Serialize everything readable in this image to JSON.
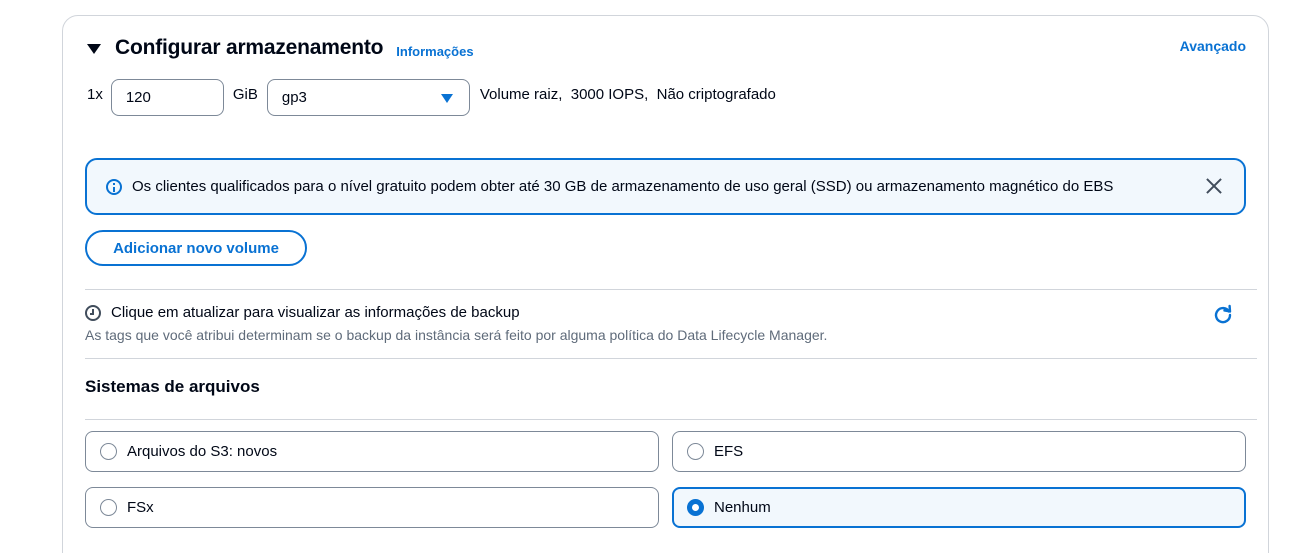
{
  "storage": {
    "title": "Configurar armazenamento",
    "info_link": "Informações",
    "advanced_link": "Avançado",
    "volume": {
      "multiplier": "1x",
      "size_value": "120",
      "unit": "GiB",
      "volume_type": "gp3",
      "description": "Volume raiz,  3000 IOPS,  Não criptografado"
    },
    "alert": {
      "icon": "info-icon",
      "text": "Os clientes qualificados para o nível gratuito podem obter até 30 GB de armazenamento de uso geral (SSD) ou armazenamento magnético do EBS"
    },
    "add_volume_label": "Adicionar novo volume",
    "backup": {
      "title": "Clique em atualizar para visualizar as informações de backup",
      "subtitle": "As tags que você atribui determinam se o backup da instância será feito por alguma política do Data Lifecycle Manager."
    }
  },
  "file_systems": {
    "title": "Sistemas de arquivos",
    "options": [
      {
        "label": "Arquivos do S3: novos",
        "selected": false
      },
      {
        "label": "EFS",
        "selected": false
      },
      {
        "label": "FSx",
        "selected": false
      },
      {
        "label": "Nenhum",
        "selected": true
      }
    ]
  },
  "colors": {
    "accent": "#0972d3",
    "info_bg": "#f2f8fd",
    "text": "#000716",
    "secondary_text": "#5f6b7a"
  }
}
